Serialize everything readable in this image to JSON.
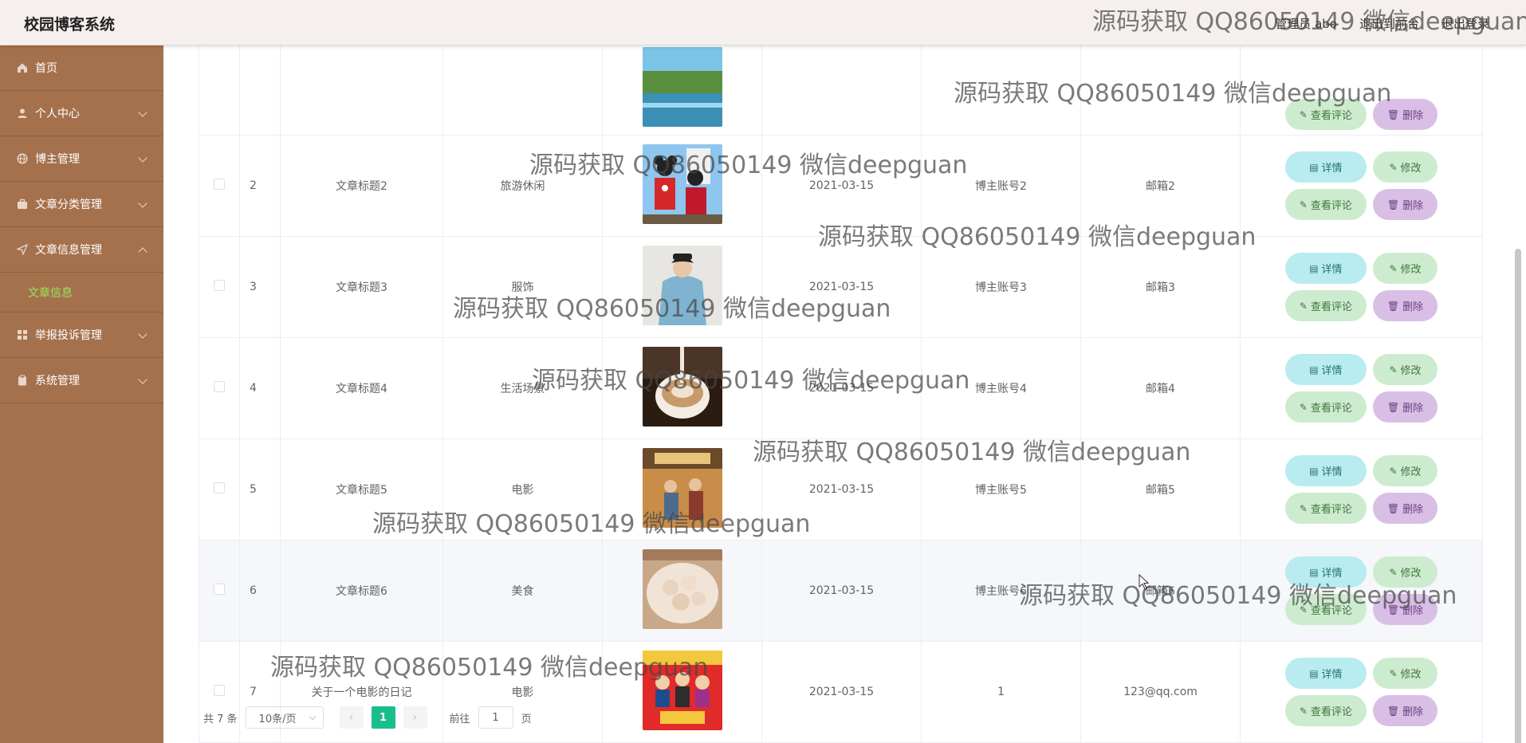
{
  "header": {
    "app_title": "校园博客系统",
    "admin_label": "管理员 abo",
    "frontend_label": "退出到前台",
    "logout_label": "退出登录"
  },
  "sidebar": {
    "items": [
      {
        "label": "首页",
        "icon": "home-icon"
      },
      {
        "label": "个人中心",
        "icon": "user-icon"
      },
      {
        "label": "博主管理",
        "icon": "globe-icon"
      },
      {
        "label": "文章分类管理",
        "icon": "briefcase-icon"
      },
      {
        "label": "文章信息管理",
        "icon": "send-icon"
      },
      {
        "label": "举报投诉管理",
        "icon": "grid-icon"
      },
      {
        "label": "系统管理",
        "icon": "clipboard-icon"
      }
    ],
    "active_sub": "文章信息"
  },
  "buttons": {
    "detail": "详情",
    "edit": "修改",
    "comment": "查看评论",
    "delete": "删除"
  },
  "rows": [
    {
      "index": "",
      "title": "",
      "category": "",
      "date": "",
      "account": "",
      "email": "",
      "thumb": "lake"
    },
    {
      "index": "2",
      "title": "文章标题2",
      "category": "旅游休闲",
      "date": "2021-03-15",
      "account": "博主账号2",
      "email": "邮箱2",
      "thumb": "mickey"
    },
    {
      "index": "3",
      "title": "文章标题3",
      "category": "服饰",
      "date": "2021-03-15",
      "account": "博主账号3",
      "email": "邮箱3",
      "thumb": "hoodie"
    },
    {
      "index": "4",
      "title": "文章标题4",
      "category": "生活场景",
      "date": "2021-03-15",
      "account": "博主账号4",
      "email": "邮箱4",
      "thumb": "coffee"
    },
    {
      "index": "5",
      "title": "文章标题5",
      "category": "电影",
      "date": "2021-03-15",
      "account": "博主账号5",
      "email": "邮箱5",
      "thumb": "movie"
    },
    {
      "index": "6",
      "title": "文章标题6",
      "category": "美食",
      "date": "2021-03-15",
      "account": "博主账号6",
      "email": "邮箱6",
      "thumb": "food"
    },
    {
      "index": "7",
      "title": "关于一个电影的日记",
      "category": "电影",
      "date": "2021-03-15",
      "account": "1",
      "email": "123@qq.com",
      "thumb": "poster"
    }
  ],
  "pagination": {
    "total": "共 7 条",
    "page_size": "10条/页",
    "current_page": "1",
    "goto_prefix": "前往",
    "goto_value": "1",
    "goto_suffix": "页"
  },
  "watermark_text": "源码获取 QQ86050149 微信deepguan",
  "colors": {
    "sidebar": "#a5714d",
    "active_sub": "#9be65d",
    "page_active": "#19be8c"
  }
}
